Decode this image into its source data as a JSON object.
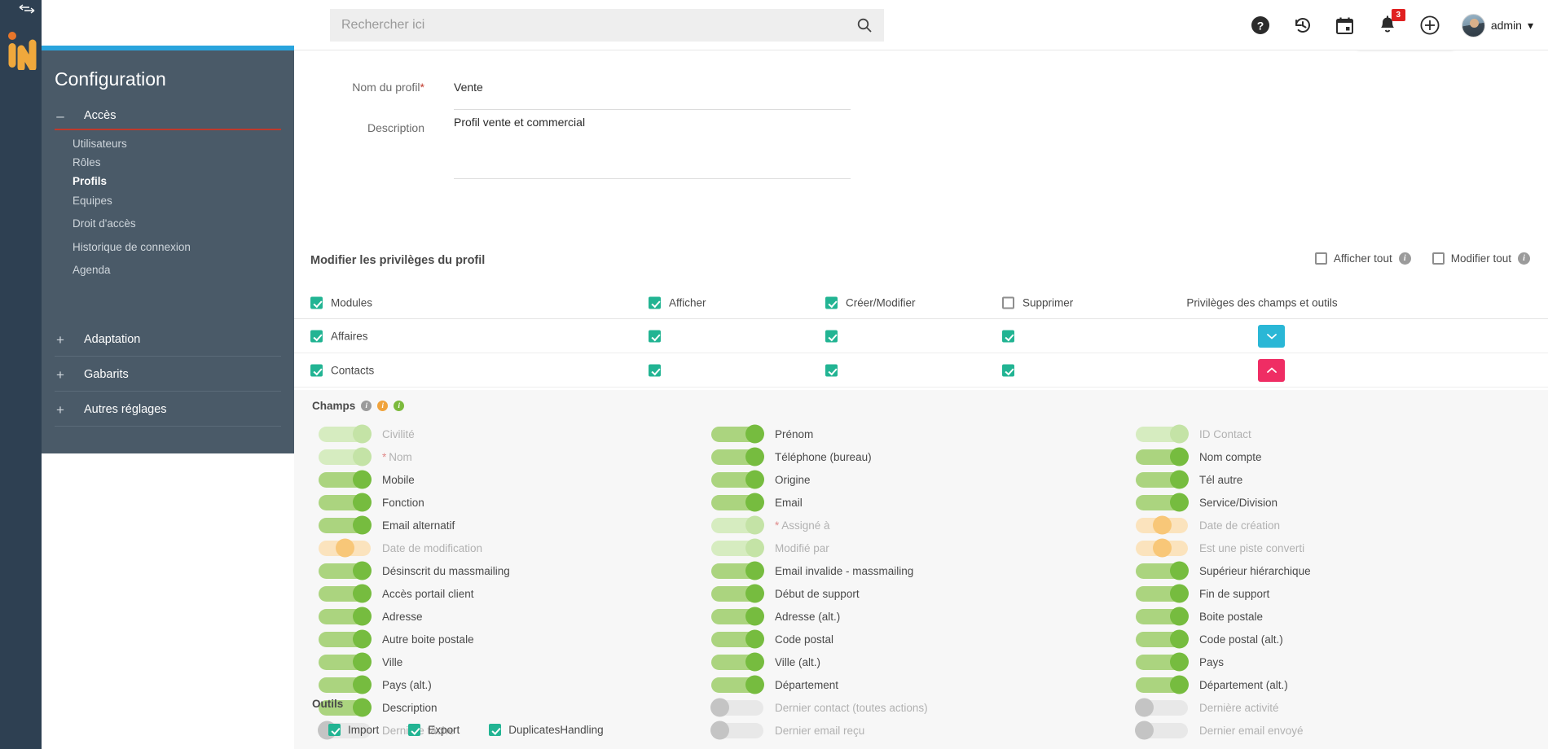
{
  "brand": {
    "logo_alt": "iN",
    "rail_collapse_icon": "collapse-arrows-icon"
  },
  "topbar": {
    "search_placeholder": "Rechercher ici",
    "search_value": "",
    "search_icon": "search-icon",
    "icons": [
      {
        "name": "help-icon",
        "label": "?"
      },
      {
        "name": "history-icon",
        "label": ""
      },
      {
        "name": "calendar-icon",
        "label": ""
      },
      {
        "name": "notifications-bell-icon",
        "label": "",
        "badge": "3"
      },
      {
        "name": "add-circle-icon",
        "label": ""
      }
    ],
    "user": {
      "name": "admin",
      "caret": "▾"
    }
  },
  "sidebar": {
    "title": "Configuration",
    "groups": [
      {
        "label": "Accès",
        "sign": "–",
        "expanded": true
      },
      {
        "label": "Adaptation",
        "sign": "+",
        "expanded": false
      },
      {
        "label": "Gabarits",
        "sign": "+",
        "expanded": false
      },
      {
        "label": "Autres réglages",
        "sign": "+",
        "expanded": false
      }
    ],
    "items": [
      {
        "label": "Utilisateurs",
        "active": false
      },
      {
        "label": "Rôles",
        "active": false
      },
      {
        "label": "Profils",
        "active": true
      },
      {
        "label": "Equipes",
        "active": false
      },
      {
        "label": "Droit d'accès",
        "active": false
      },
      {
        "label": "Historique de connexion",
        "active": false
      },
      {
        "label": "Agenda",
        "active": false
      }
    ]
  },
  "form": {
    "fields": [
      {
        "label": "Nom du profil",
        "required": true,
        "value": "Vente"
      },
      {
        "label": "Description",
        "required": false,
        "value": "Profil vente et commercial"
      }
    ]
  },
  "privileges": {
    "section_title": "Modifier les privilèges du profil",
    "head_checks": [
      {
        "label": "Afficher tout",
        "checked": false,
        "info": "info-icon"
      },
      {
        "label": "Modifier tout",
        "checked": false,
        "info": "info-icon"
      }
    ],
    "columns": {
      "modules": {
        "label": "Modules",
        "checked": true
      },
      "afficher": {
        "label": "Afficher",
        "checked": true
      },
      "creer": {
        "label": "Créer/Modifier",
        "checked": true
      },
      "supprimer": {
        "label": "Supprimer",
        "checked": false
      },
      "privileges": {
        "label": "Privilèges des champs et outils"
      }
    },
    "rows": [
      {
        "module": "Affaires",
        "module_checked": true,
        "afficher": true,
        "creer": true,
        "supprimer": true,
        "expander": {
          "state": "collapsed",
          "icon": "chevron-down-icon",
          "color": "#2ab7d6"
        }
      },
      {
        "module": "Contacts",
        "module_checked": true,
        "afficher": true,
        "creer": true,
        "supprimer": true,
        "expander": {
          "state": "expanded",
          "icon": "chevron-up-icon",
          "color": "#ef2d64"
        }
      }
    ]
  },
  "panel": {
    "fields_title": "Champs",
    "legend_dots": [
      {
        "name": "legend-grey-info-icon",
        "color": "#9b9b9b"
      },
      {
        "name": "legend-orange-info-icon",
        "color": "#f0a33c"
      },
      {
        "name": "legend-green-info-icon",
        "color": "#7cba3d"
      }
    ],
    "columns": [
      [
        {
          "label": "Civilité",
          "state": "locked",
          "required": false
        },
        {
          "label": "Nom",
          "state": "locked",
          "required": true
        },
        {
          "label": "Mobile",
          "state": "on",
          "required": false
        },
        {
          "label": "Fonction",
          "state": "on",
          "required": false
        },
        {
          "label": "Email alternatif",
          "state": "on",
          "required": false
        },
        {
          "label": "Date de modification",
          "state": "system",
          "required": false
        },
        {
          "label": "Désinscrit du massmailing",
          "state": "on",
          "required": false
        },
        {
          "label": "Accès portail client",
          "state": "on",
          "required": false
        },
        {
          "label": "Adresse",
          "state": "on",
          "required": false
        },
        {
          "label": "Autre boite postale",
          "state": "on",
          "required": false
        },
        {
          "label": "Ville",
          "state": "on",
          "required": false
        },
        {
          "label": "Pays (alt.)",
          "state": "on",
          "required": false
        },
        {
          "label": "Description",
          "state": "on",
          "required": false
        },
        {
          "label": "Dernière tâche",
          "state": "off",
          "required": false
        }
      ],
      [
        {
          "label": "Prénom",
          "state": "on",
          "required": false
        },
        {
          "label": "Téléphone (bureau)",
          "state": "on",
          "required": false
        },
        {
          "label": "Origine",
          "state": "on",
          "required": false
        },
        {
          "label": "Email",
          "state": "on",
          "required": false
        },
        {
          "label": "Assigné à",
          "state": "locked",
          "required": true
        },
        {
          "label": "Modifié par",
          "state": "locked",
          "required": false
        },
        {
          "label": "Email invalide - massmailing",
          "state": "on",
          "required": false
        },
        {
          "label": "Début de support",
          "state": "on",
          "required": false
        },
        {
          "label": "Adresse (alt.)",
          "state": "on",
          "required": false
        },
        {
          "label": "Code postal",
          "state": "on",
          "required": false
        },
        {
          "label": "Ville (alt.)",
          "state": "on",
          "required": false
        },
        {
          "label": "Département",
          "state": "on",
          "required": false
        },
        {
          "label": "Dernier contact (toutes actions)",
          "state": "off",
          "required": false
        },
        {
          "label": "Dernier email reçu",
          "state": "off",
          "required": false
        }
      ],
      [
        {
          "label": "ID Contact",
          "state": "locked",
          "required": false
        },
        {
          "label": "Nom compte",
          "state": "on",
          "required": false
        },
        {
          "label": "Tél autre",
          "state": "on",
          "required": false
        },
        {
          "label": "Service/Division",
          "state": "on",
          "required": false
        },
        {
          "label": "Date de création",
          "state": "system",
          "required": false
        },
        {
          "label": "Est une piste converti",
          "state": "system",
          "required": false
        },
        {
          "label": "Supérieur hiérarchique",
          "state": "on",
          "required": false
        },
        {
          "label": "Fin de support",
          "state": "on",
          "required": false
        },
        {
          "label": "Boite postale",
          "state": "on",
          "required": false
        },
        {
          "label": "Code postal (alt.)",
          "state": "on",
          "required": false
        },
        {
          "label": "Pays",
          "state": "on",
          "required": false
        },
        {
          "label": "Département (alt.)",
          "state": "on",
          "required": false
        },
        {
          "label": "Dernière activité",
          "state": "off",
          "required": false
        },
        {
          "label": "Dernier email envoyé",
          "state": "off",
          "required": false
        }
      ]
    ],
    "tools_title": "Outils",
    "tools": [
      {
        "label": "Import",
        "checked": true
      },
      {
        "label": "Export",
        "checked": true
      },
      {
        "label": "DuplicatesHandling",
        "checked": true
      }
    ]
  },
  "colors": {
    "rail": "#2e4052",
    "sidebar": "#4a5a68",
    "accent_blue": "#29a4dd",
    "accent_red": "#c0392b",
    "teal": "#22b493",
    "pink": "#ef2d64",
    "cyan": "#2ab7d6",
    "green_on": "#76bc3f",
    "orange_sys": "#f8c778"
  }
}
